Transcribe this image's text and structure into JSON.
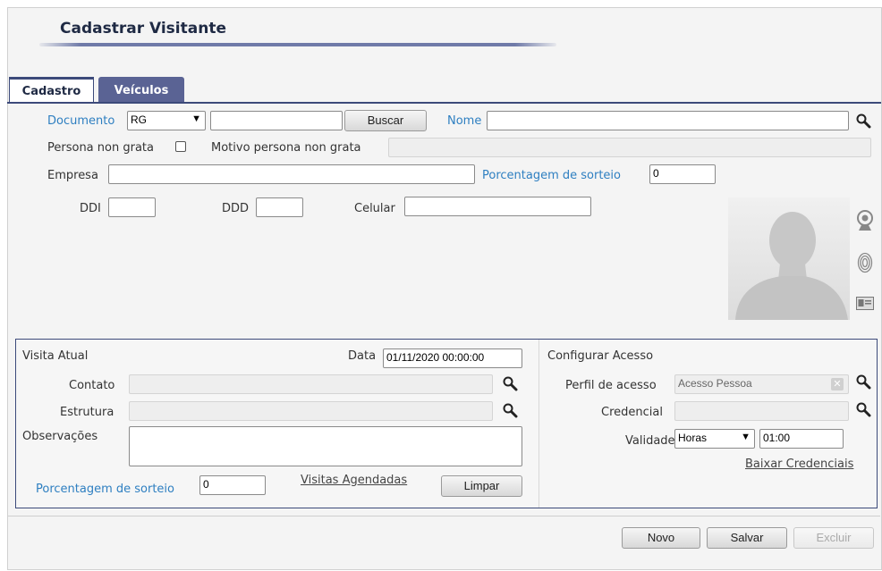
{
  "header": {
    "title": "Cadastrar Visitante"
  },
  "tabs": [
    {
      "label": "Cadastro"
    },
    {
      "label": "Veículos"
    }
  ],
  "cadastro": {
    "documento_label": "Documento",
    "documento_tipo": "RG",
    "documento_numero": "",
    "buscar_label": "Buscar",
    "nome_label": "Nome",
    "nome_value": "",
    "persona_non_grata_label": "Persona non grata",
    "persona_non_grata_checked": false,
    "motivo_label": "Motivo persona non grata",
    "motivo_value": "",
    "empresa_label": "Empresa",
    "empresa_value": "",
    "porcentagem_label": "Porcentagem de sorteio",
    "porcentagem_value": "0",
    "ddi_label": "DDI",
    "ddi_value": "",
    "ddd_label": "DDD",
    "ddd_value": "",
    "celular_label": "Celular",
    "celular_value": ""
  },
  "visita": {
    "section_label": "Visita Atual",
    "data_label": "Data",
    "data_value": "01/11/2020 00:00:00",
    "contato_label": "Contato",
    "estrutura_label": "Estrutura",
    "observacoes_label": "Observações",
    "porcentagem_label": "Porcentagem de sorteio",
    "porcentagem_value": "0",
    "visitas_agendadas_label": "Visitas Agendadas",
    "limpar_label": "Limpar"
  },
  "acesso": {
    "section_label": "Configurar Acesso",
    "perfil_label": "Perfil de acesso",
    "perfil_value": "Acesso Pessoa",
    "credencial_label": "Credencial",
    "validade_label": "Validade",
    "validade_unidade": "Horas",
    "validade_value": "01:00",
    "baixar_label": "Baixar Credenciais"
  },
  "footer": {
    "novo_label": "Novo",
    "salvar_label": "Salvar",
    "excluir_label": "Excluir"
  }
}
